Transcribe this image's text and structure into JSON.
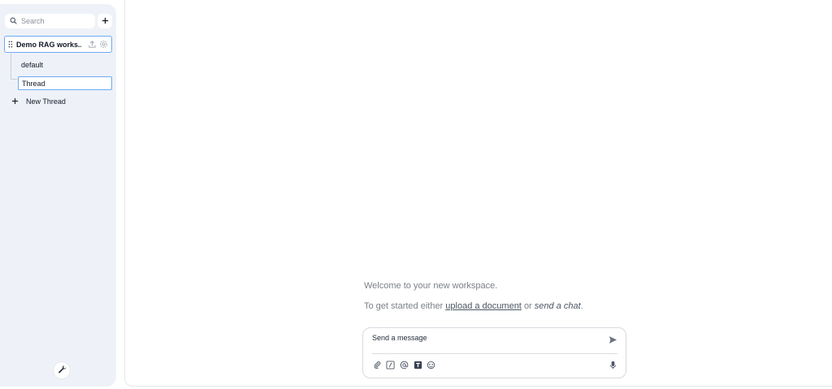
{
  "sidebar": {
    "search": {
      "placeholder": "Search",
      "icon": "search-icon"
    },
    "new_workspace_icon": "plus-icon",
    "workspace": {
      "name": "Demo RAG works...",
      "icons": [
        "drag-handle-icon",
        "upload-icon",
        "gear-icon"
      ]
    },
    "threads": [
      {
        "label": "default",
        "active": false
      },
      {
        "label": "Thread",
        "active": true
      }
    ],
    "new_thread_label": "New Thread",
    "settings_icon": "wrench-icon"
  },
  "main": {
    "welcome_text": "Welcome to your new workspace.",
    "start_prefix": "To get started either",
    "upload_link": "upload a document",
    "start_middle": "or",
    "send_chat": "send a chat",
    "start_suffix": "."
  },
  "composer": {
    "placeholder": "Send a message",
    "tools": [
      "paperclip-icon",
      "slash-command-icon",
      "at-mention-icon",
      "text-size-icon",
      "agent-icon"
    ],
    "send_icon": "send-icon",
    "mic_icon": "microphone-icon"
  },
  "colors": {
    "sidebar_bg": "#eef2f8",
    "accent_border": "#6fa8f5",
    "muted_text": "#7b8088"
  }
}
